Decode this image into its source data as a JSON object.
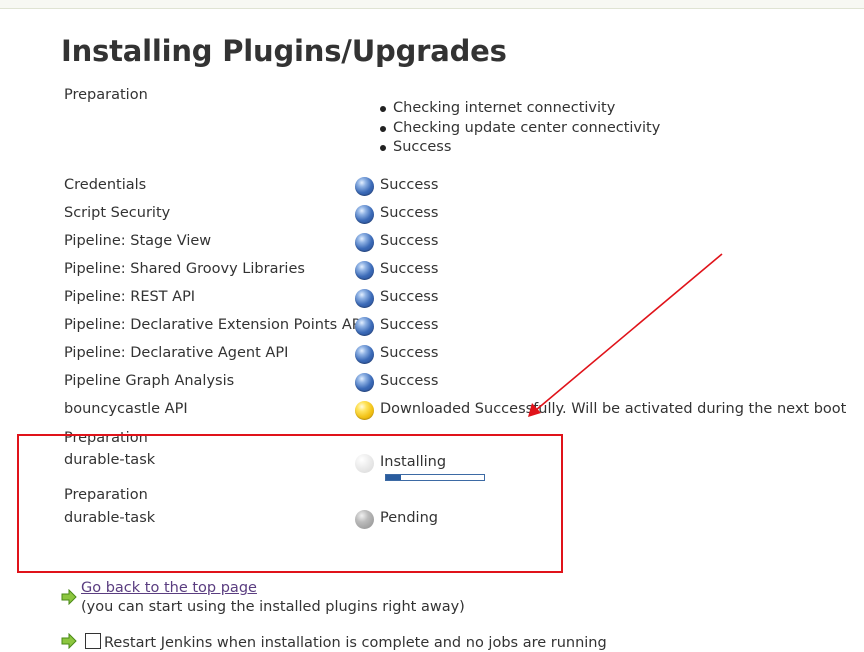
{
  "page": {
    "title": "Installing Plugins/Upgrades"
  },
  "preparation": {
    "label": "Preparation",
    "steps": [
      "Checking internet connectivity",
      "Checking update center connectivity",
      "Success"
    ]
  },
  "plugins": [
    {
      "name": "Credentials",
      "status": "Success",
      "state": "success"
    },
    {
      "name": "Script Security",
      "status": "Success",
      "state": "success"
    },
    {
      "name": "Pipeline: Stage View",
      "status": "Success",
      "state": "success"
    },
    {
      "name": "Pipeline: Shared Groovy Libraries",
      "status": "Success",
      "state": "success"
    },
    {
      "name": "Pipeline: REST API",
      "status": "Success",
      "state": "success"
    },
    {
      "name": "Pipeline: Declarative Extension Points API",
      "status": "Success",
      "state": "success"
    },
    {
      "name": "Pipeline: Declarative Agent API",
      "status": "Success",
      "state": "success"
    },
    {
      "name": "Pipeline Graph Analysis",
      "status": "Success",
      "state": "success"
    },
    {
      "name": "bouncycastle API",
      "status": "Downloaded Successfully. Will be activated during the next boot",
      "state": "downloaded"
    }
  ],
  "highlighted": {
    "installing": {
      "prep_label": "Preparation",
      "name": "durable-task",
      "status": "Installing",
      "progress": 0.15
    },
    "pending": {
      "prep_label": "Preparation",
      "name": "durable-task",
      "status": "Pending"
    }
  },
  "footer": {
    "back_link": "Go back to the top page",
    "back_note": "(you can start using the installed plugins right away)",
    "restart_label": "Restart Jenkins when installation is complete and no jobs are running",
    "restart_checked": false
  },
  "colors": {
    "annotation_red": "#e0131a",
    "progress_fill": "#2a5c9e",
    "link": "#5a3d80"
  }
}
